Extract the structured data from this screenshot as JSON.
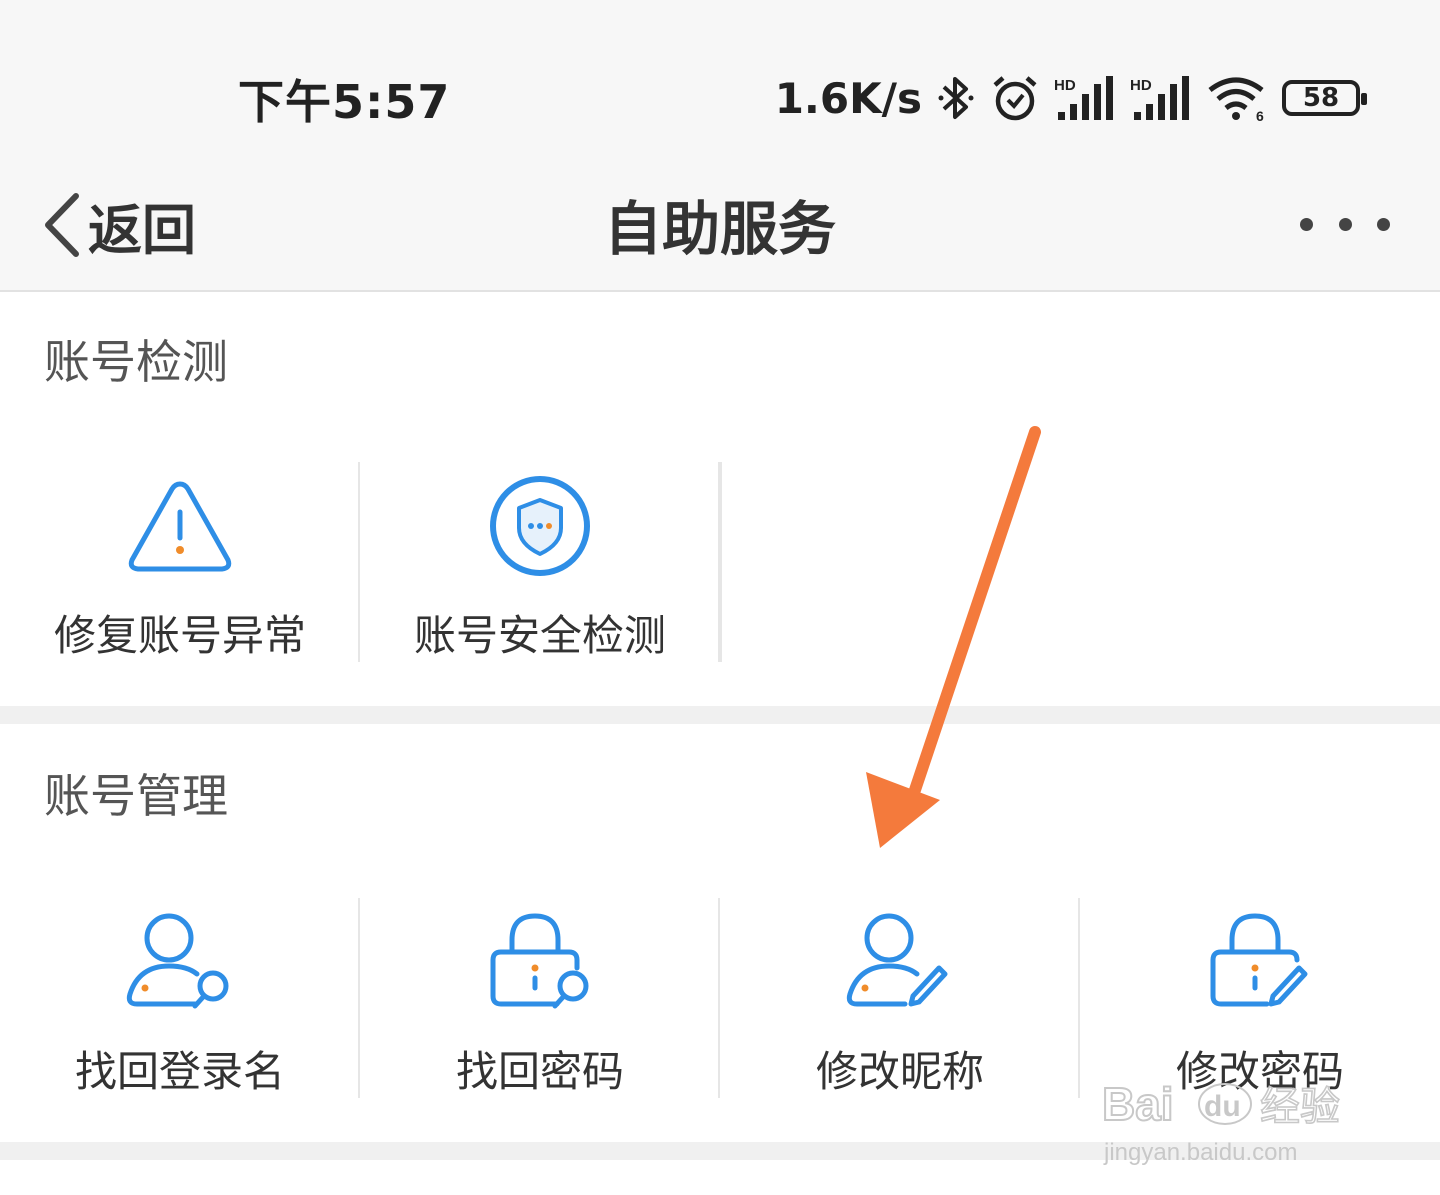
{
  "status_bar": {
    "time": "下午5:57",
    "net_speed": "1.6K/s",
    "battery": "58",
    "icons": [
      "bluetooth-icon",
      "alarm-icon",
      "hd-signal-icon",
      "hd-signal-icon",
      "wifi-icon",
      "battery-icon"
    ]
  },
  "nav": {
    "back_label": "返回",
    "title": "自助服务",
    "more_icon": "more-icon"
  },
  "sections": [
    {
      "title": "账号检测",
      "items": [
        {
          "label": "修复账号异常",
          "icon": "warning-icon"
        },
        {
          "label": "账号安全检测",
          "icon": "shield-icon"
        }
      ]
    },
    {
      "title": "账号管理",
      "items": [
        {
          "label": "找回登录名",
          "icon": "user-search-icon"
        },
        {
          "label": "找回密码",
          "icon": "lock-search-icon"
        },
        {
          "label": "修改昵称",
          "icon": "user-edit-icon"
        },
        {
          "label": "修改密码",
          "icon": "lock-edit-icon"
        }
      ]
    }
  ],
  "annotation": {
    "arrow_color": "#f47a3c",
    "points_to": "修改昵称"
  },
  "watermark": {
    "brand": "Baidu经验",
    "url": "jingyan.baidu.com"
  },
  "colors": {
    "accent": "#2e8ee6",
    "accent_dot": "#f08c2a",
    "arrow": "#f47a3c"
  }
}
